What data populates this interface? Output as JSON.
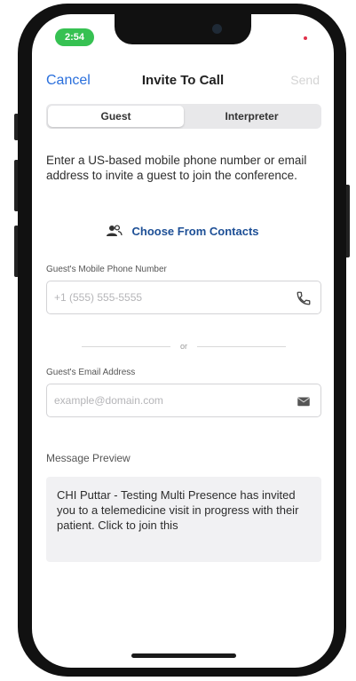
{
  "status_bar": {
    "time": "2:54"
  },
  "nav": {
    "cancel_label": "Cancel",
    "title": "Invite To Call",
    "send_label": "Send"
  },
  "tabs": [
    {
      "label": "Guest",
      "selected": true
    },
    {
      "label": "Interpreter",
      "selected": false
    }
  ],
  "instructions": "Enter a US-based mobile phone number or email address to invite a guest to join the conference.",
  "contacts": {
    "label": "Choose From Contacts",
    "icon": "contacts-icon"
  },
  "phone_field": {
    "label": "Guest's Mobile Phone Number",
    "placeholder": "+1 (555) 555-5555",
    "value": "",
    "icon": "phone-icon"
  },
  "divider": {
    "label": "or"
  },
  "email_field": {
    "label": "Guest's Email Address",
    "placeholder": "example@domain.com",
    "value": "",
    "icon": "mail-icon"
  },
  "message": {
    "label": "Message Preview",
    "text": "CHI Puttar - Testing Multi Presence has invited you to a telemedicine visit in progress with their patient. Click to join this"
  },
  "colors": {
    "accent": "#2a6fdc",
    "contacts_link": "#1d4f96",
    "status_green": "#36c152",
    "message_bg": "#f1f1f3"
  }
}
